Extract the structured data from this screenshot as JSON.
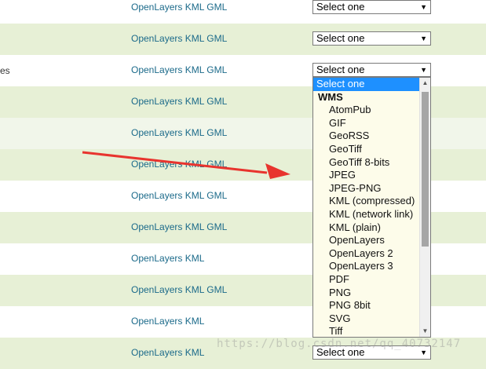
{
  "rows": [
    {
      "label": "",
      "links": "OpenLayers KML GML",
      "select": "Select one"
    },
    {
      "label": "",
      "links": "OpenLayers KML GML",
      "select": "Select one"
    },
    {
      "label": "es",
      "links": "OpenLayers KML GML",
      "select": "Select one"
    },
    {
      "label": "",
      "links": "OpenLayers KML GML",
      "select": ""
    },
    {
      "label": "",
      "links": "OpenLayers KML GML",
      "select": ""
    },
    {
      "label": "",
      "links": "OpenLayers KML GML",
      "select": ""
    },
    {
      "label": "",
      "links": "OpenLayers KML GML",
      "select": ""
    },
    {
      "label": "",
      "links": "OpenLayers KML GML",
      "select": ""
    },
    {
      "label": "",
      "links": "OpenLayers KML",
      "select": ""
    },
    {
      "label": "",
      "links": "OpenLayers KML GML",
      "select": ""
    },
    {
      "label": "",
      "links": "OpenLayers KML",
      "select": ""
    },
    {
      "label": "",
      "links": "OpenLayers KML",
      "select": "Select one"
    }
  ],
  "dropdown": {
    "selected": "Select one",
    "group": "WMS",
    "options": [
      "AtomPub",
      "GIF",
      "GeoRSS",
      "GeoTiff",
      "GeoTiff 8-bits",
      "JPEG",
      "JPEG-PNG",
      "KML (compressed)",
      "KML (network link)",
      "KML (plain)",
      "OpenLayers",
      "OpenLayers 2",
      "OpenLayers 3",
      "PDF",
      "PNG",
      "PNG 8bit",
      "SVG",
      "Tiff"
    ]
  },
  "watermark": "https://blog.csdn.net/qq_40732147",
  "colors": {
    "link": "#1b6a8a",
    "row_alt": "#e7f0d6",
    "selected": "#1e90ff",
    "annotation_arrow": "#e8342e"
  },
  "icons": {
    "select_arrow": "chevron-down-icon",
    "annotation": "red-arrow-annotation"
  }
}
